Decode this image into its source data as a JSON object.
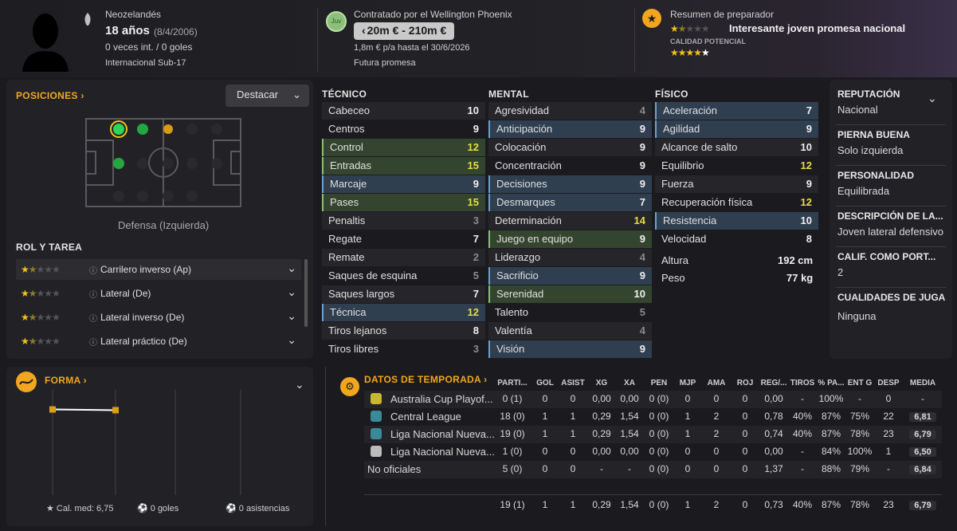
{
  "header": {
    "nationality": "Neozelandés",
    "age": "18 años",
    "birth": "(8/4/2006)",
    "caps": "0 veces int. / 0 goles",
    "intl_level": "Internacional Sub-17",
    "contract_badge": "Juv",
    "contract_with": "Contratado por el Wellington Phoenix",
    "value_range": "20m € - 210m €",
    "wage": "1,8m € p/a hasta el 30/6/2026",
    "status": "Futura promesa",
    "coach_title": "Resumen de preparador",
    "coach_summary": "Interesante joven promesa nacional",
    "potential_label": "CALIDAD POTENCIAL",
    "current_stars": 1.5,
    "potential_stars": 4.5
  },
  "positions": {
    "title": "POSICIONES",
    "highlight_btn": "Destacar",
    "position_label": "Defensa (Izquierda)"
  },
  "roles": {
    "title": "ROL Y TAREA",
    "items": [
      {
        "label": "Carrilero inverso (Ap)",
        "stars": 1.5
      },
      {
        "label": "Lateral (De)",
        "stars": 1.5
      },
      {
        "label": "Lateral inverso (De)",
        "stars": 1.5
      },
      {
        "label": "Lateral práctico (De)",
        "stars": 1.5
      }
    ]
  },
  "technical": {
    "title": "TÉCNICO",
    "items": [
      {
        "name": "Cabeceo",
        "value": "10",
        "hl": ""
      },
      {
        "name": "Centros",
        "value": "9",
        "hl": ""
      },
      {
        "name": "Control",
        "value": "12",
        "hl": "green"
      },
      {
        "name": "Entradas",
        "value": "15",
        "hl": "green"
      },
      {
        "name": "Marcaje",
        "value": "9",
        "hl": "blue"
      },
      {
        "name": "Pases",
        "value": "15",
        "hl": "green"
      },
      {
        "name": "Penaltis",
        "value": "3",
        "hl": ""
      },
      {
        "name": "Regate",
        "value": "7",
        "hl": ""
      },
      {
        "name": "Remate",
        "value": "2",
        "hl": ""
      },
      {
        "name": "Saques de esquina",
        "value": "5",
        "hl": ""
      },
      {
        "name": "Saques largos",
        "value": "7",
        "hl": ""
      },
      {
        "name": "Técnica",
        "value": "12",
        "hl": "blue"
      },
      {
        "name": "Tiros lejanos",
        "value": "8",
        "hl": ""
      },
      {
        "name": "Tiros libres",
        "value": "3",
        "hl": ""
      }
    ]
  },
  "mental": {
    "title": "MENTAL",
    "items": [
      {
        "name": "Agresividad",
        "value": "4",
        "hl": ""
      },
      {
        "name": "Anticipación",
        "value": "9",
        "hl": "blue"
      },
      {
        "name": "Colocación",
        "value": "9",
        "hl": ""
      },
      {
        "name": "Concentración",
        "value": "9",
        "hl": ""
      },
      {
        "name": "Decisiones",
        "value": "9",
        "hl": "blue"
      },
      {
        "name": "Desmarques",
        "value": "7",
        "hl": "blue"
      },
      {
        "name": "Determinación",
        "value": "14",
        "hl": ""
      },
      {
        "name": "Juego en equipo",
        "value": "9",
        "hl": "green"
      },
      {
        "name": "Liderazgo",
        "value": "4",
        "hl": ""
      },
      {
        "name": "Sacrificio",
        "value": "9",
        "hl": "blue"
      },
      {
        "name": "Serenidad",
        "value": "10",
        "hl": "green"
      },
      {
        "name": "Talento",
        "value": "5",
        "hl": ""
      },
      {
        "name": "Valentía",
        "value": "4",
        "hl": ""
      },
      {
        "name": "Visión",
        "value": "9",
        "hl": "blue"
      }
    ]
  },
  "physical": {
    "title": "FÍSICO",
    "items": [
      {
        "name": "Aceleración",
        "value": "7",
        "hl": "blue"
      },
      {
        "name": "Agilidad",
        "value": "9",
        "hl": "blue"
      },
      {
        "name": "Alcance de salto",
        "value": "10",
        "hl": ""
      },
      {
        "name": "Equilibrio",
        "value": "12",
        "hl": ""
      },
      {
        "name": "Fuerza",
        "value": "9",
        "hl": ""
      },
      {
        "name": "Recuperación física",
        "value": "12",
        "hl": ""
      },
      {
        "name": "Resistencia",
        "value": "10",
        "hl": "blue"
      },
      {
        "name": "Velocidad",
        "value": "8",
        "hl": ""
      }
    ],
    "height_label": "Altura",
    "height": "192 cm",
    "weight_label": "Peso",
    "weight": "77 kg"
  },
  "side": {
    "reputation_label": "REPUTACIÓN",
    "reputation": "Nacional",
    "foot_label": "PIERNA BUENA",
    "foot": "Solo izquierda",
    "personality_label": "PERSONALIDAD",
    "personality": "Equilibrada",
    "description_label": "DESCRIPCIÓN DE LA...",
    "description": "Joven lateral defensivo",
    "gk_label": "CALIF. COMO PORT...",
    "gk": "2",
    "qualities_label": "CUALIDADES DE JUGA",
    "qualities": "Ninguna"
  },
  "form": {
    "title": "FORMA",
    "avg": "Cal. med: 6,75",
    "goals": "0 goles",
    "assists": "0 asistencias",
    "ratings": [
      6.81,
      6.79
    ]
  },
  "season": {
    "title": "DATOS DE TEMPORADA",
    "headers": [
      "PARTI...",
      "GOL",
      "ASIST",
      "XG",
      "XA",
      "PEN",
      "MJP",
      "AMA",
      "ROJ",
      "REG/...",
      "TIROS",
      "% PA...",
      "ENT G",
      "DESP",
      "MEDIA"
    ],
    "rows": [
      {
        "comp": "Australia Cup Playof...",
        "cells": [
          "0 (1)",
          "0",
          "0",
          "0,00",
          "0,00",
          "0 (0)",
          "0",
          "0",
          "0",
          "0,00",
          "-",
          "100%",
          "-",
          "0",
          "-"
        ]
      },
      {
        "comp": "Central League",
        "cells": [
          "18 (0)",
          "1",
          "1",
          "0,29",
          "1,54",
          "0 (0)",
          "1",
          "2",
          "0",
          "0,78",
          "40%",
          "87%",
          "75%",
          "22",
          "6,81"
        ]
      },
      {
        "comp": "Liga Nacional Nueva...",
        "cells": [
          "19 (0)",
          "1",
          "1",
          "0,29",
          "1,54",
          "0 (0)",
          "1",
          "2",
          "0",
          "0,74",
          "40%",
          "87%",
          "78%",
          "23",
          "6,79"
        ]
      },
      {
        "comp": "Liga Nacional Nueva...",
        "cells": [
          "1 (0)",
          "0",
          "0",
          "0,00",
          "0,00",
          "0 (0)",
          "0",
          "0",
          "0",
          "0,00",
          "-",
          "84%",
          "100%",
          "1",
          "6,50"
        ]
      },
      {
        "comp": "No oficiales",
        "cells": [
          "5 (0)",
          "0",
          "0",
          "-",
          "-",
          "0 (0)",
          "0",
          "0",
          "0",
          "1,37",
          "-",
          "88%",
          "79%",
          "-",
          "6,84"
        ]
      }
    ],
    "total": [
      "19 (1)",
      "1",
      "1",
      "0,29",
      "1,54",
      "0 (0)",
      "1",
      "2",
      "0",
      "0,73",
      "40%",
      "87%",
      "78%",
      "23",
      "6,79"
    ]
  }
}
